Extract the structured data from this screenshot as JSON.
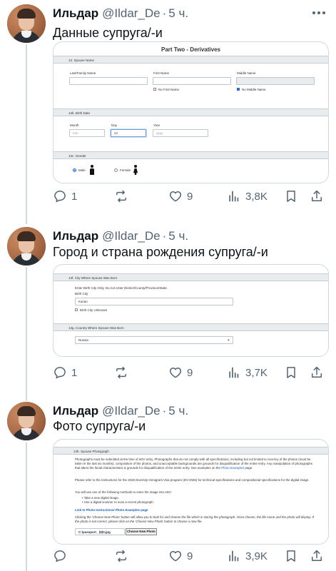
{
  "tweets": [
    {
      "name": "Ильдар",
      "handle": "@Ildar_De",
      "dot": "·",
      "time": "5 ч.",
      "text": "Данные супруга/-и",
      "replies": "1",
      "likes": "9",
      "views": "3,8K",
      "form": {
        "title": "Part Two - Derivatives",
        "sec_name": "13. Spouse Name",
        "last_label": "Last/Family Name",
        "first_label": "First Name",
        "middle_label": "Middle Name",
        "no_first": "No First Name",
        "no_middle": "No Middle Name",
        "sec_birth": "13b. Birth Date",
        "month_label": "Month",
        "day_label": "Day",
        "year_label": "Year",
        "month_ph": "mm",
        "day_ph": "dd",
        "year_ph": "yyyy",
        "sec_gender": "13c. Gender",
        "male": "Male",
        "female": "Female"
      }
    },
    {
      "name": "Ильдар",
      "handle": "@Ildar_De",
      "dot": "·",
      "time": "5 ч.",
      "text": "Город и страна рождения супруга/-и",
      "replies": "1",
      "likes": "9",
      "views": "3,7K",
      "form": {
        "sec_city": "13f. City Where Spouse Was Born",
        "instruction": "Enter Birth City Only. Do not enter District/County/Province/State.",
        "city_label": "Birth City",
        "city_value": "Kazan",
        "city_unknown": "Birth City Unknown",
        "sec_country": "13g. Country Where Spouse Was Born",
        "country_value": "Russia"
      }
    },
    {
      "name": "Ильдар",
      "handle": "@Ildar_De",
      "dot": "·",
      "time": "5 ч.",
      "text": "Фото супруга/-и",
      "replies": "",
      "likes": "9",
      "views": "3,9K",
      "form": {
        "sec_photo": "13h. Spouse Photograph",
        "p1": "Photographs must be submitted at the time of eDV entry. Photographs that do not comply with all specifications, including but not limited to recency of the photos (must be taken in the last six months), composition of the photos, and unacceptable backgrounds are grounds for disqualification of the entire entry. Any manipulation of photographs that alters the facial characteristics is grounds for disqualification of the entire entry. See examples on the",
        "p1_link": "Photo Examples",
        "p1_end": "page.",
        "p2": "Please refer to the instructions for the 2026 Diversity Immigrant Visa program (DV-2026) for technical specifications and compositional specifications for the digital image.",
        "p3": "You will use one of the following methods to enter the image into eDV:",
        "b1": "Take a new digital image.",
        "b2": "Use a digital scanner to scan a recent photograph.",
        "link": "Link to Photo Instructions/ Photo Examples page",
        "p4": "Clicking the 'Choose New Photo' button will allow you to look for and choose the file which is storing the photograph. Once chosen, the file name and the photo will display. If the photo is not correct, please click on the 'Choose New Photo' button to choose a new file.",
        "file_value": "C:\\passport_ (8)0.jpg",
        "choose_btn": "Choose New Photo"
      }
    }
  ],
  "icons": {
    "reply": "reply-icon",
    "retweet": "retweet-icon",
    "like": "heart-icon",
    "views": "views-icon",
    "bookmark": "bookmark-icon",
    "more": "more-icon"
  },
  "colors": {
    "text": "#0f1419",
    "muted": "#536471",
    "border": "#cfd9de",
    "link": "#1a5fb4"
  }
}
